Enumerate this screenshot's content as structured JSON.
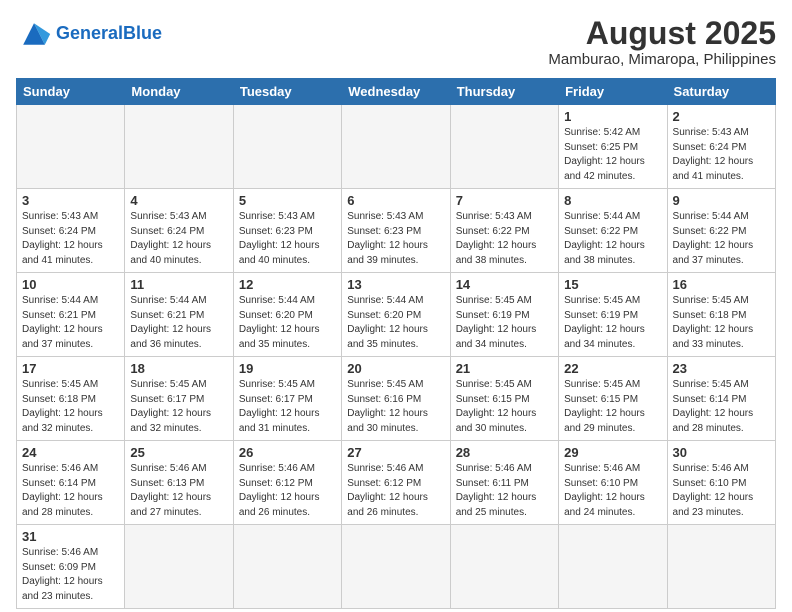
{
  "header": {
    "logo_general": "General",
    "logo_blue": "Blue",
    "title": "August 2025",
    "subtitle": "Mamburao, Mimaropa, Philippines"
  },
  "days_of_week": [
    "Sunday",
    "Monday",
    "Tuesday",
    "Wednesday",
    "Thursday",
    "Friday",
    "Saturday"
  ],
  "weeks": [
    [
      {
        "day": "",
        "info": ""
      },
      {
        "day": "",
        "info": ""
      },
      {
        "day": "",
        "info": ""
      },
      {
        "day": "",
        "info": ""
      },
      {
        "day": "",
        "info": ""
      },
      {
        "day": "1",
        "info": "Sunrise: 5:42 AM\nSunset: 6:25 PM\nDaylight: 12 hours\nand 42 minutes."
      },
      {
        "day": "2",
        "info": "Sunrise: 5:43 AM\nSunset: 6:24 PM\nDaylight: 12 hours\nand 41 minutes."
      }
    ],
    [
      {
        "day": "3",
        "info": "Sunrise: 5:43 AM\nSunset: 6:24 PM\nDaylight: 12 hours\nand 41 minutes."
      },
      {
        "day": "4",
        "info": "Sunrise: 5:43 AM\nSunset: 6:24 PM\nDaylight: 12 hours\nand 40 minutes."
      },
      {
        "day": "5",
        "info": "Sunrise: 5:43 AM\nSunset: 6:23 PM\nDaylight: 12 hours\nand 40 minutes."
      },
      {
        "day": "6",
        "info": "Sunrise: 5:43 AM\nSunset: 6:23 PM\nDaylight: 12 hours\nand 39 minutes."
      },
      {
        "day": "7",
        "info": "Sunrise: 5:43 AM\nSunset: 6:22 PM\nDaylight: 12 hours\nand 38 minutes."
      },
      {
        "day": "8",
        "info": "Sunrise: 5:44 AM\nSunset: 6:22 PM\nDaylight: 12 hours\nand 38 minutes."
      },
      {
        "day": "9",
        "info": "Sunrise: 5:44 AM\nSunset: 6:22 PM\nDaylight: 12 hours\nand 37 minutes."
      }
    ],
    [
      {
        "day": "10",
        "info": "Sunrise: 5:44 AM\nSunset: 6:21 PM\nDaylight: 12 hours\nand 37 minutes."
      },
      {
        "day": "11",
        "info": "Sunrise: 5:44 AM\nSunset: 6:21 PM\nDaylight: 12 hours\nand 36 minutes."
      },
      {
        "day": "12",
        "info": "Sunrise: 5:44 AM\nSunset: 6:20 PM\nDaylight: 12 hours\nand 35 minutes."
      },
      {
        "day": "13",
        "info": "Sunrise: 5:44 AM\nSunset: 6:20 PM\nDaylight: 12 hours\nand 35 minutes."
      },
      {
        "day": "14",
        "info": "Sunrise: 5:45 AM\nSunset: 6:19 PM\nDaylight: 12 hours\nand 34 minutes."
      },
      {
        "day": "15",
        "info": "Sunrise: 5:45 AM\nSunset: 6:19 PM\nDaylight: 12 hours\nand 34 minutes."
      },
      {
        "day": "16",
        "info": "Sunrise: 5:45 AM\nSunset: 6:18 PM\nDaylight: 12 hours\nand 33 minutes."
      }
    ],
    [
      {
        "day": "17",
        "info": "Sunrise: 5:45 AM\nSunset: 6:18 PM\nDaylight: 12 hours\nand 32 minutes."
      },
      {
        "day": "18",
        "info": "Sunrise: 5:45 AM\nSunset: 6:17 PM\nDaylight: 12 hours\nand 32 minutes."
      },
      {
        "day": "19",
        "info": "Sunrise: 5:45 AM\nSunset: 6:17 PM\nDaylight: 12 hours\nand 31 minutes."
      },
      {
        "day": "20",
        "info": "Sunrise: 5:45 AM\nSunset: 6:16 PM\nDaylight: 12 hours\nand 30 minutes."
      },
      {
        "day": "21",
        "info": "Sunrise: 5:45 AM\nSunset: 6:15 PM\nDaylight: 12 hours\nand 30 minutes."
      },
      {
        "day": "22",
        "info": "Sunrise: 5:45 AM\nSunset: 6:15 PM\nDaylight: 12 hours\nand 29 minutes."
      },
      {
        "day": "23",
        "info": "Sunrise: 5:45 AM\nSunset: 6:14 PM\nDaylight: 12 hours\nand 28 minutes."
      }
    ],
    [
      {
        "day": "24",
        "info": "Sunrise: 5:46 AM\nSunset: 6:14 PM\nDaylight: 12 hours\nand 28 minutes."
      },
      {
        "day": "25",
        "info": "Sunrise: 5:46 AM\nSunset: 6:13 PM\nDaylight: 12 hours\nand 27 minutes."
      },
      {
        "day": "26",
        "info": "Sunrise: 5:46 AM\nSunset: 6:12 PM\nDaylight: 12 hours\nand 26 minutes."
      },
      {
        "day": "27",
        "info": "Sunrise: 5:46 AM\nSunset: 6:12 PM\nDaylight: 12 hours\nand 26 minutes."
      },
      {
        "day": "28",
        "info": "Sunrise: 5:46 AM\nSunset: 6:11 PM\nDaylight: 12 hours\nand 25 minutes."
      },
      {
        "day": "29",
        "info": "Sunrise: 5:46 AM\nSunset: 6:10 PM\nDaylight: 12 hours\nand 24 minutes."
      },
      {
        "day": "30",
        "info": "Sunrise: 5:46 AM\nSunset: 6:10 PM\nDaylight: 12 hours\nand 23 minutes."
      }
    ],
    [
      {
        "day": "31",
        "info": "Sunrise: 5:46 AM\nSunset: 6:09 PM\nDaylight: 12 hours\nand 23 minutes."
      },
      {
        "day": "",
        "info": ""
      },
      {
        "day": "",
        "info": ""
      },
      {
        "day": "",
        "info": ""
      },
      {
        "day": "",
        "info": ""
      },
      {
        "day": "",
        "info": ""
      },
      {
        "day": "",
        "info": ""
      }
    ]
  ]
}
